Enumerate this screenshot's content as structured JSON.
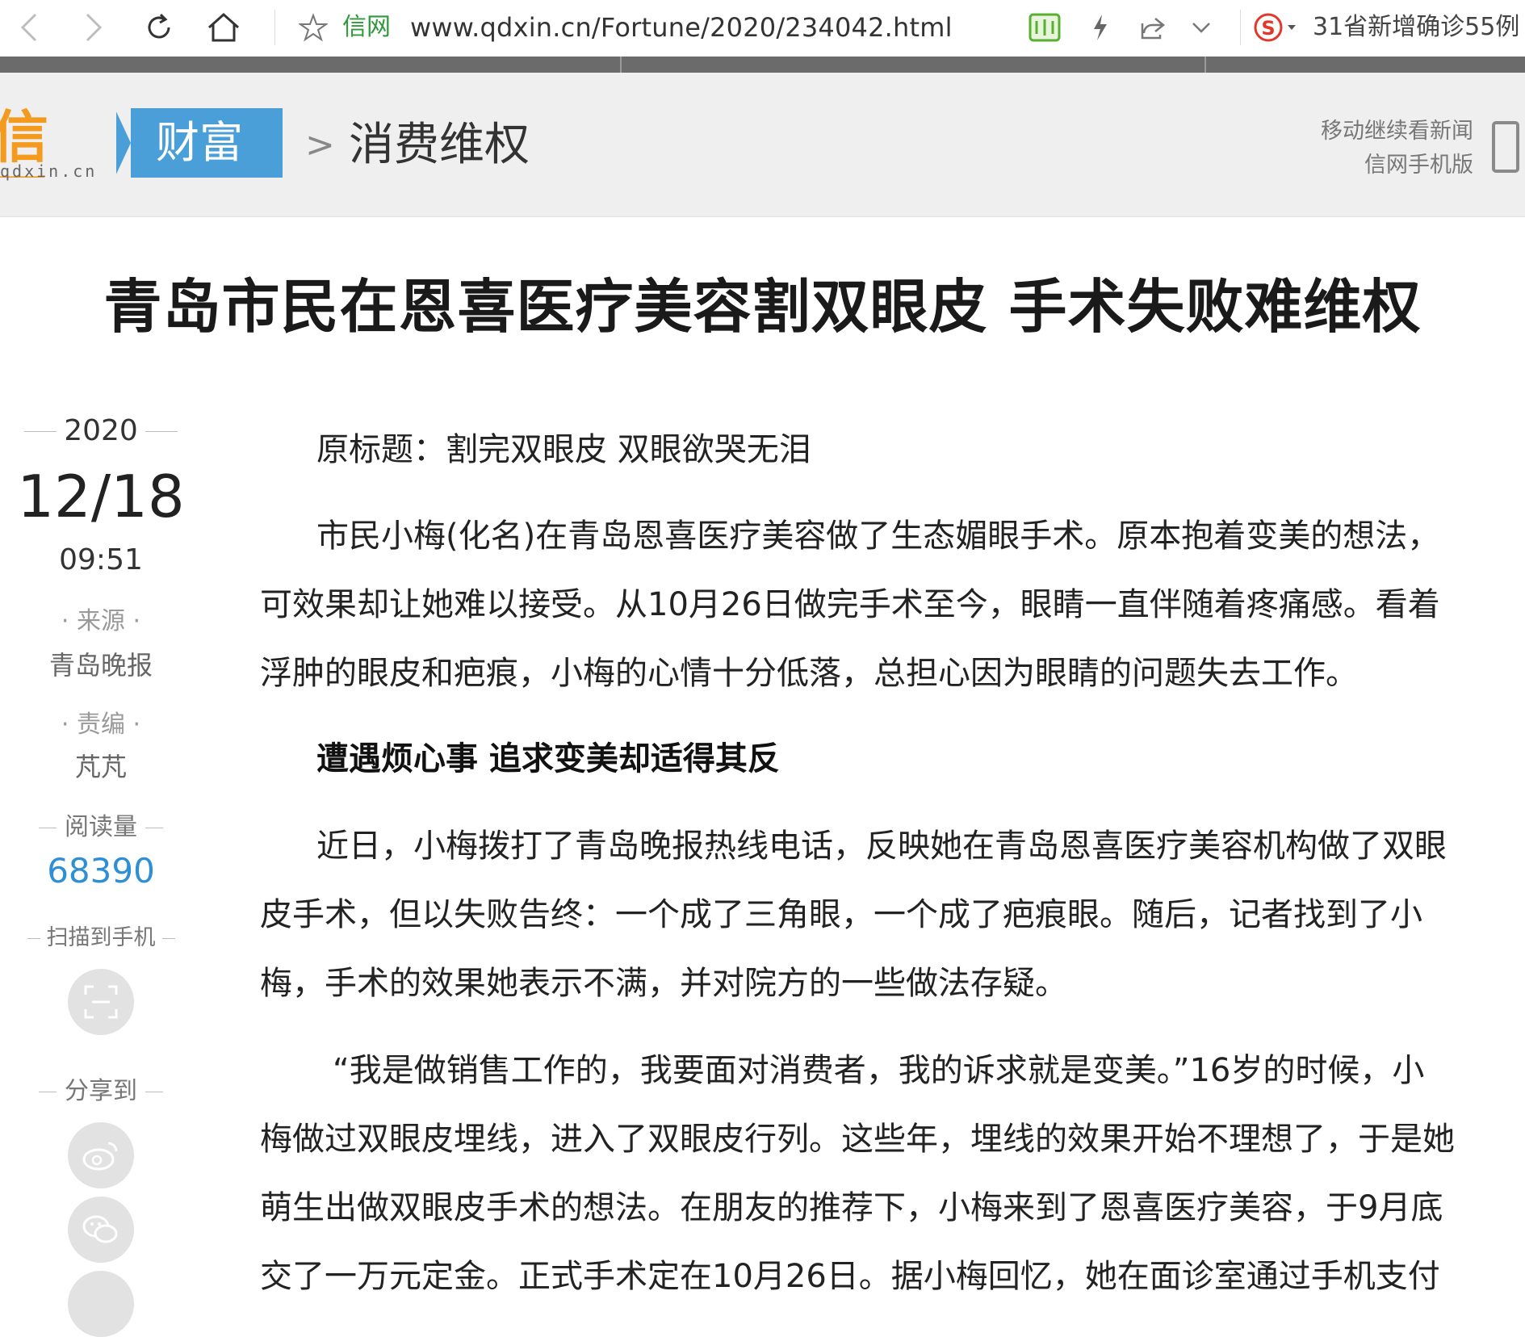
{
  "browser": {
    "site_name": "信网",
    "url": "www.qdxin.cn/Fortune/2020/234042.html",
    "news_ticker": "31省新增确诊55例"
  },
  "site": {
    "logo_text": "信网",
    "logo_domain": "qdxin.cn",
    "channel": "财富",
    "crumb_separator": ">",
    "subchannel": "消费维权",
    "mobile_line1": "移动继续看新闻",
    "mobile_line2": "信网手机版"
  },
  "article": {
    "headline": "青岛市民在恩喜医疗美容割双眼皮 手术失败难维权",
    "year": "2020",
    "date": "12/18",
    "time": "09:51",
    "source_label": "· 来源 ·",
    "source": "青岛晚报",
    "editor_label": "· 责编 ·",
    "editor": "芃芃",
    "reads_label": "阅读量",
    "reads": "68390",
    "scan_label": "扫描到手机",
    "share_label": "分享到",
    "original_title": "原标题：割完双眼皮 双眼欲哭无泪",
    "p1_l1": "市民小梅(化名)在青岛恩喜医疗美容做了生态媚眼手术。原本抱着变美的想法，",
    "p1_l2": "可效果却让她难以接受。从10月26日做完手术至今，眼睛一直伴随着疼痛感。看着",
    "p1_l3": "浮肿的眼皮和疤痕，小梅的心情十分低落，总担心因为眼睛的问题失去工作。",
    "subhead": "遭遇烦心事 追求变美却适得其反",
    "p2_l1": "近日，小梅拨打了青岛晚报热线电话，反映她在青岛恩喜医疗美容机构做了双眼",
    "p2_l2": "皮手术，但以失败告终：一个成了三角眼，一个成了疤痕眼。随后，记者找到了小",
    "p2_l3": "梅，手术的效果她表示不满，并对院方的一些做法存疑。",
    "p3_l1": "“我是做销售工作的，我要面对消费者，我的诉求就是变美。”16岁的时候，小",
    "p3_l2": "梅做过双眼皮埋线，进入了双眼皮行列。这些年，埋线的效果开始不理想了，于是她",
    "p3_l3": "萌生出做双眼皮手术的想法。在朋友的推荐下，小梅来到了恩喜医疗美容，于9月底",
    "p3_l4": "交了一万元定金。正式手术定在10月26日。据小梅回忆，她在面诊室通过手机支付"
  },
  "colors": {
    "channel_bg": "#4a9fd8",
    "logo": "#f39a1f",
    "reads": "#2f8fd4",
    "site_name_green": "#2e9a3a"
  }
}
